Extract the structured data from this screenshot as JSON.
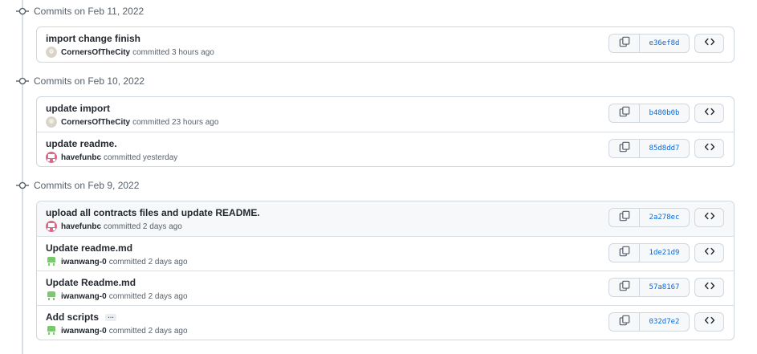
{
  "groups": [
    {
      "title": "Commits on Feb 11, 2022",
      "commits": [
        {
          "message": "import change finish",
          "author": "CornersOfTheCity",
          "action": "committed",
          "time": "3 hours ago",
          "sha": "e36ef8d",
          "avatar": "gray",
          "ellipsis": false,
          "highlight": false
        }
      ]
    },
    {
      "title": "Commits on Feb 10, 2022",
      "commits": [
        {
          "message": "update import",
          "author": "CornersOfTheCity",
          "action": "committed",
          "time": "23 hours ago",
          "sha": "b480b0b",
          "avatar": "gray",
          "ellipsis": false,
          "highlight": false
        },
        {
          "message": "update readme.",
          "author": "havefunbc",
          "action": "committed",
          "time": "yesterday",
          "sha": "85d8dd7",
          "avatar": "pink",
          "ellipsis": false,
          "highlight": false
        }
      ]
    },
    {
      "title": "Commits on Feb 9, 2022",
      "commits": [
        {
          "message": "upload all contracts files and update README.",
          "author": "havefunbc",
          "action": "committed",
          "time": "2 days ago",
          "sha": "2a278ec",
          "avatar": "pink",
          "ellipsis": false,
          "highlight": true
        },
        {
          "message": "Update readme.md",
          "author": "iwanwang-0",
          "action": "committed",
          "time": "2 days ago",
          "sha": "1de21d9",
          "avatar": "green",
          "ellipsis": false,
          "highlight": false
        },
        {
          "message": "Update Readme.md",
          "author": "iwanwang-0",
          "action": "committed",
          "time": "2 days ago",
          "sha": "57a8167",
          "avatar": "green",
          "ellipsis": false,
          "highlight": false
        },
        {
          "message": "Add scripts",
          "author": "iwanwang-0",
          "action": "committed",
          "time": "2 days ago",
          "sha": "032d7e2",
          "avatar": "green",
          "ellipsis": true,
          "highlight": false
        }
      ]
    }
  ],
  "ellipsis_label": "…",
  "colors": {
    "link": "#0969da",
    "border": "#d0d7de",
    "pink_avatar": "#e0668a",
    "green_avatar": "#7bc96f",
    "gray_avatar": "#d8d5c8"
  }
}
